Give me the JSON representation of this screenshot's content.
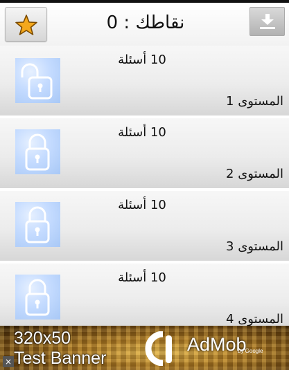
{
  "header": {
    "score_label": "نقاطك :",
    "score_value": "0",
    "favorite_icon": "star-icon",
    "download_icon": "download-icon"
  },
  "levels": [
    {
      "questions": "10 أسئلة",
      "title": "المستوى",
      "number": "1",
      "icon": "unlocked-padlock-icon"
    },
    {
      "questions": "10 أسئلة",
      "title": "المستوى",
      "number": "2",
      "icon": "locked-padlock-icon"
    },
    {
      "questions": "10 أسئلة",
      "title": "المستوى",
      "number": "3",
      "icon": "locked-padlock-icon"
    },
    {
      "questions": "10 أسئلة",
      "title": "المستوى",
      "number": "4",
      "icon": "locked-padlock-icon"
    }
  ],
  "ad": {
    "line1": "320x50",
    "line2": "Test Banner",
    "brand": "AdMob",
    "brand_by": "by Google",
    "close": "×"
  },
  "colors": {
    "star": "#f4a81c",
    "lock_tile": "#bcd6ff",
    "ad_gold": "#b07a22"
  }
}
